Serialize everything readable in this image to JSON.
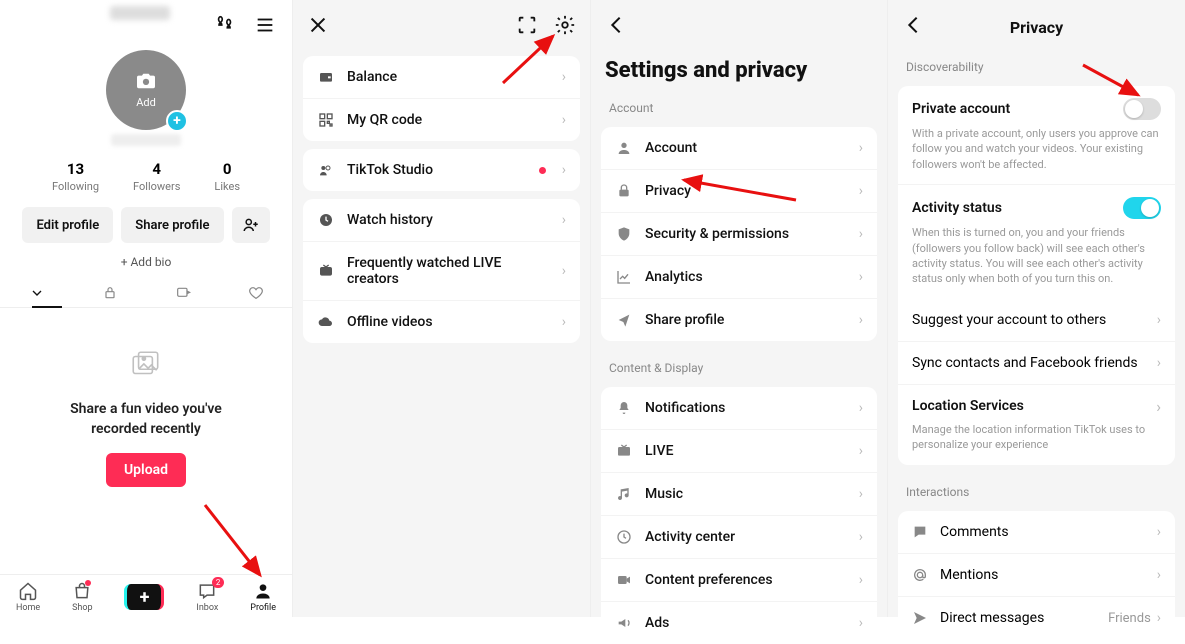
{
  "panel1": {
    "avatar_add": "Add",
    "stats": [
      {
        "num": "13",
        "label": "Following"
      },
      {
        "num": "4",
        "label": "Followers"
      },
      {
        "num": "0",
        "label": "Likes"
      }
    ],
    "edit_profile": "Edit profile",
    "share_profile": "Share profile",
    "add_bio": "+ Add bio",
    "empty_text": "Share a fun video you've\nrecorded recently",
    "upload": "Upload",
    "nav": [
      {
        "label": "Home"
      },
      {
        "label": "Shop"
      },
      {
        "label": ""
      },
      {
        "label": "Inbox",
        "badge": "2"
      },
      {
        "label": "Profile"
      }
    ]
  },
  "panel2": {
    "rows": [
      {
        "icon": "wallet",
        "label": "Balance"
      },
      {
        "icon": "qr",
        "label": "My QR code"
      },
      {
        "icon": "studio",
        "label": "TikTok Studio",
        "dot": true
      },
      {
        "icon": "clock",
        "label": "Watch history"
      },
      {
        "icon": "live",
        "label": "Frequently watched LIVE creators"
      },
      {
        "icon": "cloud",
        "label": "Offline videos"
      }
    ]
  },
  "panel3": {
    "title": "Settings and privacy",
    "section1": "Account",
    "rows1": [
      {
        "icon": "person",
        "label": "Account"
      },
      {
        "icon": "lock",
        "label": "Privacy"
      },
      {
        "icon": "shield",
        "label": "Security & permissions"
      },
      {
        "icon": "chart",
        "label": "Analytics"
      },
      {
        "icon": "share",
        "label": "Share profile"
      }
    ],
    "section2": "Content & Display",
    "rows2": [
      {
        "icon": "bell",
        "label": "Notifications"
      },
      {
        "icon": "tv",
        "label": "LIVE"
      },
      {
        "icon": "music",
        "label": "Music"
      },
      {
        "icon": "activity",
        "label": "Activity center"
      },
      {
        "icon": "video",
        "label": "Content preferences"
      },
      {
        "icon": "ads",
        "label": "Ads"
      }
    ]
  },
  "panel4": {
    "title": "Privacy",
    "section1": "Discoverability",
    "private_account": {
      "title": "Private account",
      "desc": "With a private account, only users you approve can follow you and watch your videos. Your existing followers won't be affected.",
      "on": false
    },
    "activity_status": {
      "title": "Activity status",
      "desc": "When this is turned on, you and your friends (followers you follow back) will see each other's activity status. You will see each other's activity status only when both of you turn this on.",
      "on": true
    },
    "rows1": [
      {
        "label": "Suggest your account to others"
      },
      {
        "label": "Sync contacts and Facebook friends"
      },
      {
        "label": "Location Services",
        "desc": "Manage the location information TikTok uses to personalize your experience"
      }
    ],
    "section2": "Interactions",
    "rows2": [
      {
        "icon": "comment",
        "label": "Comments"
      },
      {
        "icon": "at",
        "label": "Mentions"
      },
      {
        "icon": "send",
        "label": "Direct messages",
        "value": "Friends"
      }
    ]
  }
}
